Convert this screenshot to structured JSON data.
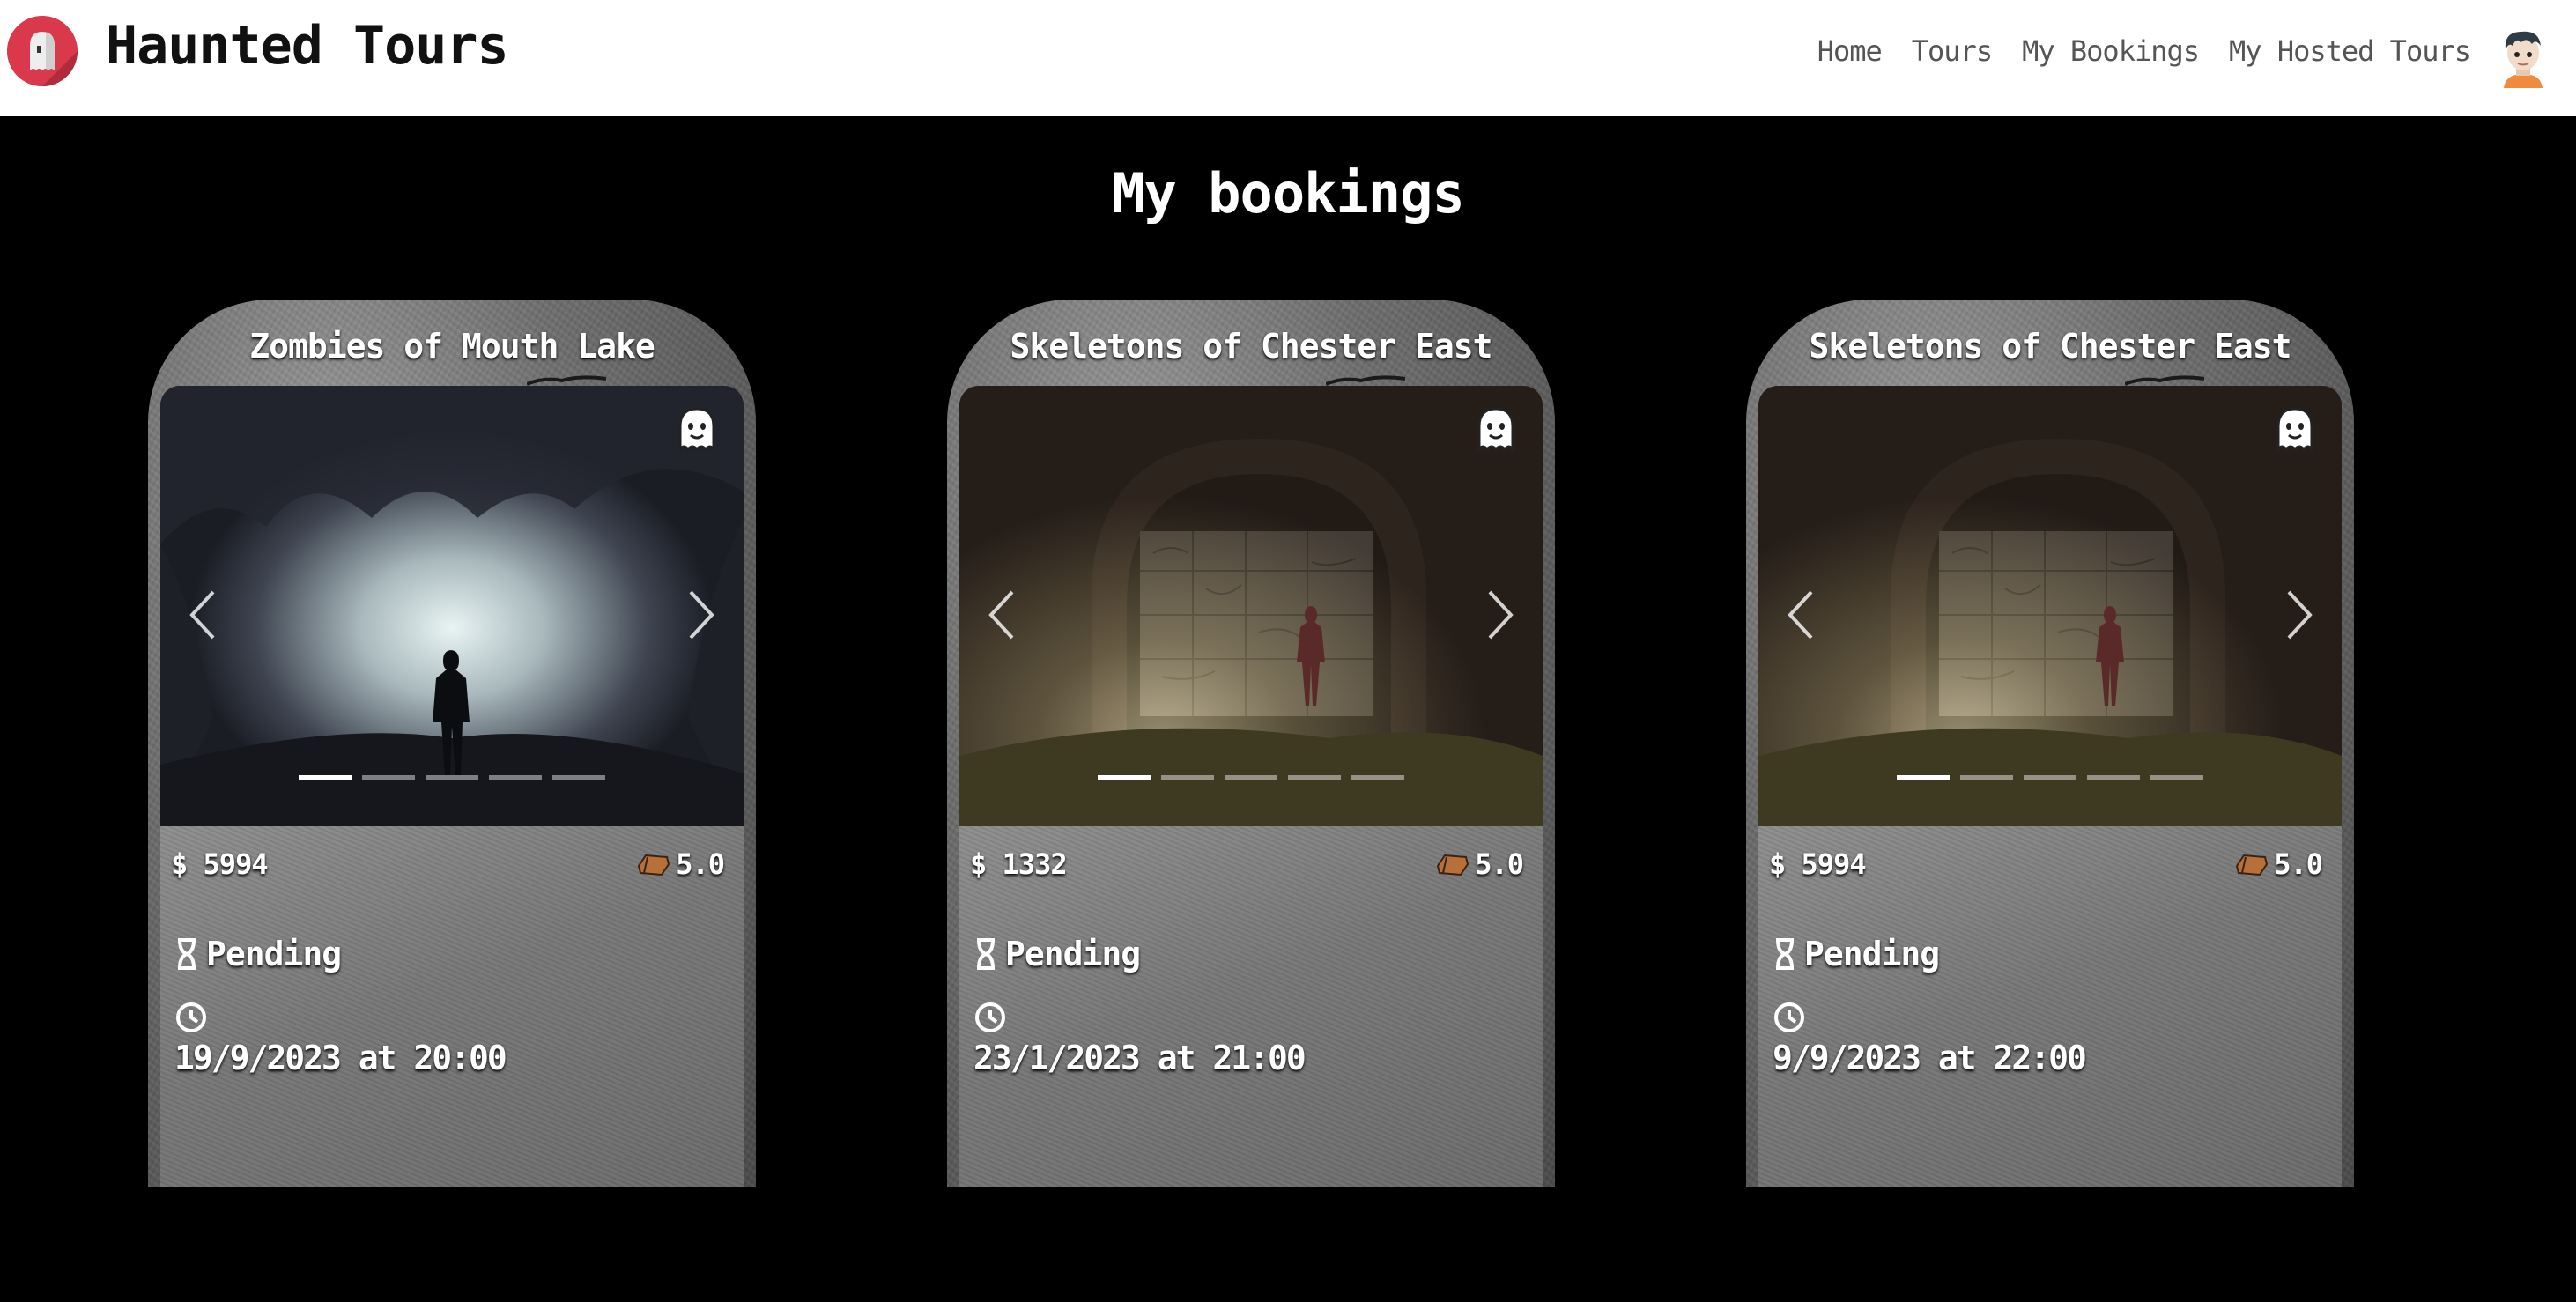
{
  "app": {
    "brand": "Haunted Tours",
    "logo_icon": "ghost-logo-icon",
    "accent_color": "#d9394a"
  },
  "nav": {
    "items": [
      {
        "label": "Home"
      },
      {
        "label": "Tours"
      },
      {
        "label": "My Bookings"
      },
      {
        "label": "My Hosted Tours"
      }
    ],
    "avatar_icon": "user-avatar-icon"
  },
  "page": {
    "title": "My bookings"
  },
  "bookings": [
    {
      "title": "Zombies of Mouth Lake",
      "price": "5994",
      "currency_icon": "dollar-icon",
      "rating": "5.0",
      "rating_icon": "coffin-icon",
      "status": "Pending",
      "status_icon": "hourglass-icon",
      "datetime": "19/9/2023 at 20:00",
      "image": "forest-figure",
      "slides": 5,
      "active_slide": 1
    },
    {
      "title": "Skeletons of Chester East",
      "price": "1332",
      "currency_icon": "dollar-icon",
      "rating": "5.0",
      "rating_icon": "coffin-icon",
      "status": "Pending",
      "status_icon": "hourglass-icon",
      "datetime": "23/1/2023 at 21:00",
      "image": "tunnel-girl",
      "slides": 5,
      "active_slide": 1
    },
    {
      "title": "Skeletons of Chester East",
      "price": "5994",
      "currency_icon": "dollar-icon",
      "rating": "5.0",
      "rating_icon": "coffin-icon",
      "status": "Pending",
      "status_icon": "hourglass-icon",
      "datetime": "9/9/2023 at 22:00",
      "image": "tunnel-girl",
      "slides": 5,
      "active_slide": 1
    }
  ]
}
